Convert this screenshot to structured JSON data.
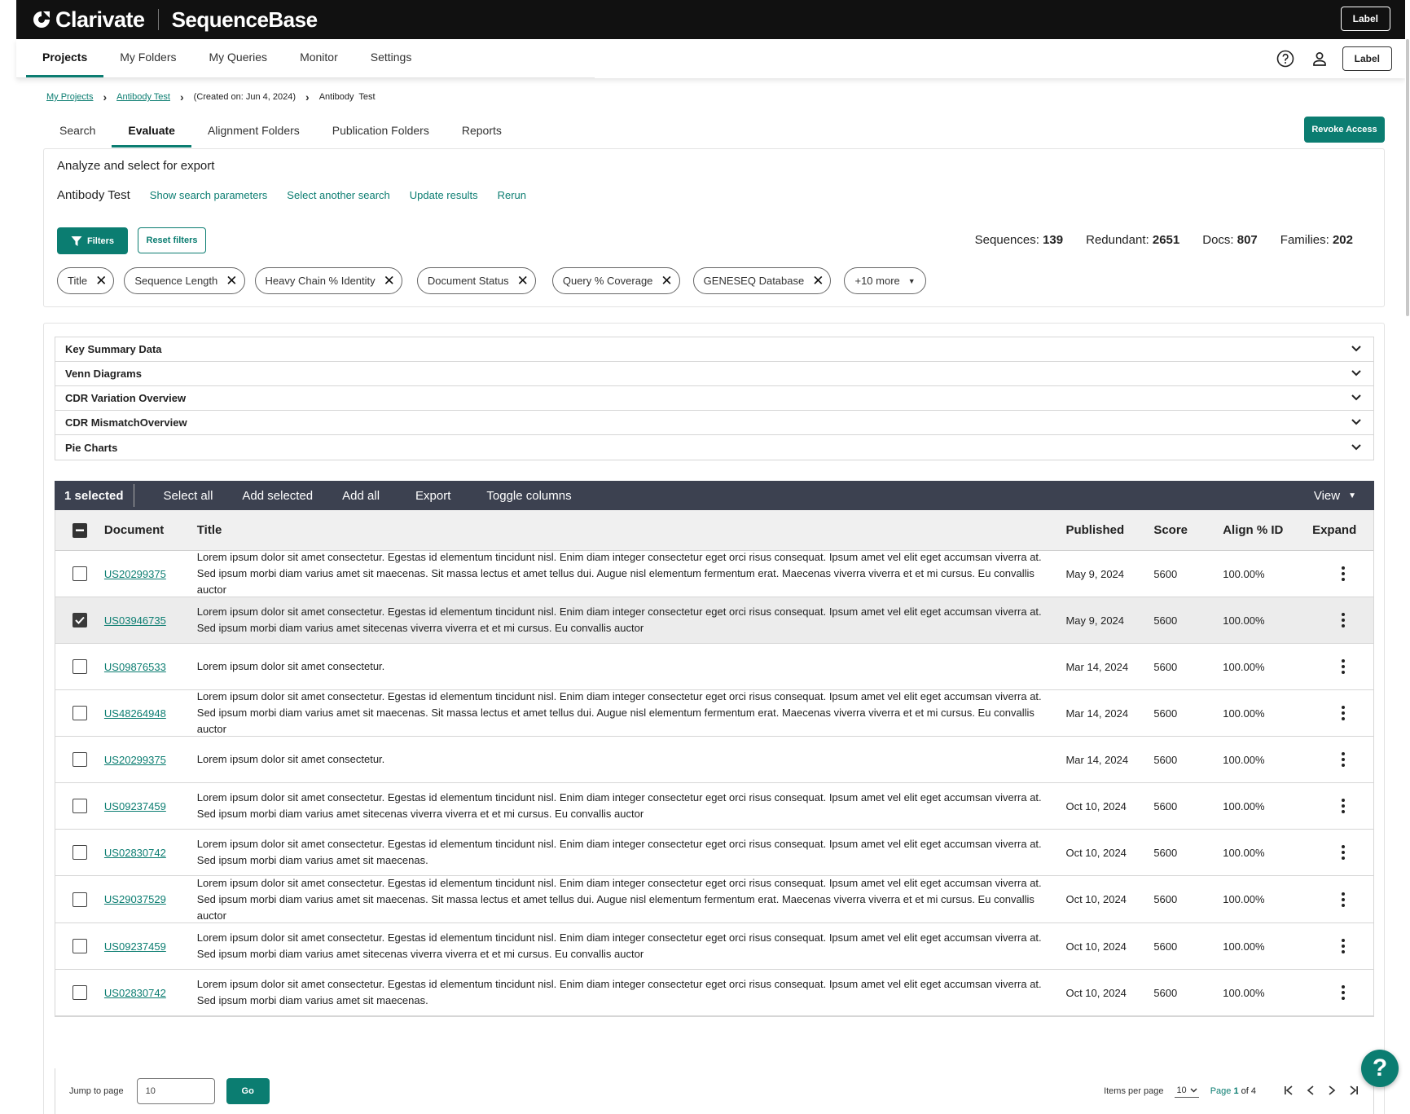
{
  "header": {
    "brand": "Clarivate",
    "product": "SequenceBase",
    "label_button": "Label"
  },
  "mainnav": {
    "tabs": [
      "Projects",
      "My Folders",
      "My Queries",
      "Monitor",
      "Settings"
    ],
    "active": "Projects",
    "label_button": "Label"
  },
  "breadcrumb": {
    "my_projects": "My Projects",
    "project": "Antibody Test",
    "created": "(Created on: Jun 4, 2024)",
    "current": "Antibody  Test"
  },
  "subtabs": {
    "items": [
      "Search",
      "Evaluate",
      "Alignment Folders",
      "Publication Folders",
      "Reports"
    ],
    "active": "Evaluate",
    "revoke_button": "Revoke Access"
  },
  "analyze": {
    "heading": "Analyze and select for export",
    "search_name": "Antibody Test",
    "links": [
      "Show search parameters",
      "Select another search",
      "Update results",
      "Rerun"
    ],
    "filters_button": "Filters",
    "reset_button": "Reset filters",
    "stats": [
      {
        "label": "Sequences:",
        "value": "139"
      },
      {
        "label": "Redundant:",
        "value": "2651"
      },
      {
        "label": "Docs:",
        "value": "807"
      },
      {
        "label": "Families:",
        "value": "202"
      }
    ],
    "chips": [
      "Title",
      "Sequence Length",
      "Heavy Chain % Identity",
      "Document Status",
      "Query % Coverage",
      "GENESEQ Database"
    ],
    "more_chip": "+10 more"
  },
  "accordion": [
    "Key Summary Data",
    "Venn Diagrams",
    "CDR Variation Overview",
    "CDR MismatchOverview",
    "Pie Charts"
  ],
  "toolbar": {
    "selected": "1 selected",
    "actions": [
      "Select all",
      "Add selected",
      "Add all",
      "Export",
      "Toggle columns"
    ],
    "view": "View"
  },
  "table": {
    "columns": [
      "Document",
      "Title",
      "Published",
      "Score",
      "Align % ID",
      "Expand"
    ],
    "rows": [
      {
        "doc": "US20299375",
        "title": "Lorem ipsum dolor sit amet consectetur. Egestas id elementum tincidunt nisl. Enim diam integer consectetur eget orci risus consequat. Ipsum amet vel elit eget accumsan viverra at. Sed ipsum morbi diam varius amet sit maecenas. Sit massa lectus et amet tellus dui. Augue nisl elementum fermentum erat. Maecenas viverra viverra et et mi cursus. Eu convallis auctor",
        "published": "May 9, 2024",
        "score": "5600",
        "align": "100.00%",
        "checked": false
      },
      {
        "doc": "US03946735",
        "title": "Lorem ipsum dolor sit amet consectetur. Egestas id elementum tincidunt nisl. Enim diam integer consectetur eget orci risus consequat. Ipsum amet vel elit eget accumsan viverra at. Sed ipsum morbi diam varius amet sitecenas viverra viverra et et mi cursus. Eu convallis auctor",
        "published": "May 9, 2024",
        "score": "5600",
        "align": "100.00%",
        "checked": true
      },
      {
        "doc": "US09876533",
        "title": "Lorem ipsum dolor sit amet consectetur.",
        "published": "Mar 14, 2024",
        "score": "5600",
        "align": "100.00%",
        "checked": false
      },
      {
        "doc": "US48264948",
        "title": "Lorem ipsum dolor sit amet consectetur. Egestas id elementum tincidunt nisl. Enim diam integer consectetur eget orci risus consequat. Ipsum amet vel elit eget accumsan viverra at. Sed ipsum morbi diam varius amet sit maecenas. Sit massa lectus et amet tellus dui. Augue nisl elementum fermentum erat. Maecenas viverra viverra et et mi cursus. Eu convallis auctor",
        "published": "Mar 14, 2024",
        "score": "5600",
        "align": "100.00%",
        "checked": false
      },
      {
        "doc": "US20299375",
        "title": "Lorem ipsum dolor sit amet consectetur.",
        "published": "Mar 14, 2024",
        "score": "5600",
        "align": "100.00%",
        "checked": false
      },
      {
        "doc": "US09237459",
        "title": "Lorem ipsum dolor sit amet consectetur. Egestas id elementum tincidunt nisl. Enim diam integer consectetur eget orci risus consequat. Ipsum amet vel elit eget accumsan viverra at. Sed ipsum morbi diam varius amet sitecenas viverra viverra et et mi cursus. Eu convallis auctor",
        "published": "Oct 10, 2024",
        "score": "5600",
        "align": "100.00%",
        "checked": false
      },
      {
        "doc": "US02830742",
        "title": "Lorem ipsum dolor sit amet consectetur. Egestas id elementum tincidunt nisl. Enim diam integer consectetur eget orci risus consequat. Ipsum amet vel elit eget accumsan viverra at. Sed ipsum morbi diam varius amet sit maecenas.",
        "published": "Oct 10, 2024",
        "score": "5600",
        "align": "100.00%",
        "checked": false
      },
      {
        "doc": "US29037529",
        "title": "Lorem ipsum dolor sit amet consectetur. Egestas id elementum tincidunt nisl. Enim diam integer consectetur eget orci risus consequat. Ipsum amet vel elit eget accumsan viverra at. Sed ipsum morbi diam varius amet sit maecenas. Sit massa lectus et amet tellus dui. Augue nisl elementum fermentum erat. Maecenas viverra viverra et et mi cursus. Eu convallis auctor",
        "published": "Oct 10, 2024",
        "score": "5600",
        "align": "100.00%",
        "checked": false
      },
      {
        "doc": "US09237459",
        "title": "Lorem ipsum dolor sit amet consectetur. Egestas id elementum tincidunt nisl. Enim diam integer consectetur eget orci risus consequat. Ipsum amet vel elit eget accumsan viverra at. Sed ipsum morbi diam varius amet sitecenas viverra viverra et et mi cursus. Eu convallis auctor",
        "published": "Oct 10, 2024",
        "score": "5600",
        "align": "100.00%",
        "checked": false
      },
      {
        "doc": "US02830742",
        "title": "Lorem ipsum dolor sit amet consectetur. Egestas id elementum tincidunt nisl. Enim diam integer consectetur eget orci risus consequat. Ipsum amet vel elit eget accumsan viverra at. Sed ipsum morbi diam varius amet sit maecenas.",
        "published": "Oct 10, 2024",
        "score": "5600",
        "align": "100.00%",
        "checked": false
      }
    ]
  },
  "pager": {
    "jump_label": "Jump to page",
    "jump_value": "10",
    "go_button": "Go",
    "items_per_page_label": "Items per page",
    "items_per_page": "10",
    "page_prefix": "Page",
    "page_current": "1",
    "page_of": "of 4"
  },
  "help_fab": "?",
  "colors": {
    "accent": "#0b7d71",
    "toolbar": "#3c4150",
    "header": "#111111"
  }
}
